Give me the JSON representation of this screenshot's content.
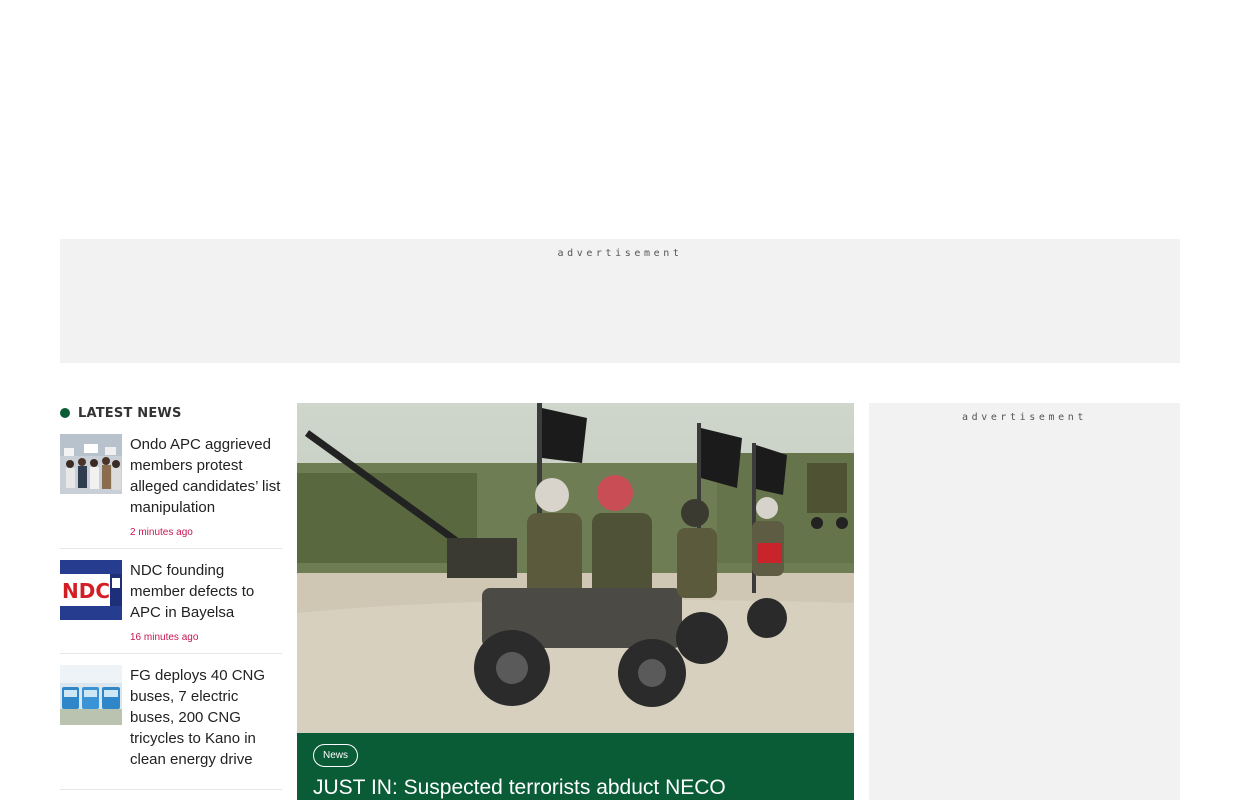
{
  "ads": {
    "banner_label": "advertisement",
    "sidebar_label": "advertisement"
  },
  "latest_news": {
    "title": "LATEST NEWS",
    "items": [
      {
        "headline": "Ondo APC aggrieved members protest alleged candidates’ list manipulation",
        "time": "2 minutes ago",
        "thumb_icon": "protest-photo"
      },
      {
        "headline": "NDC founding member defects to APC in Bayelsa",
        "time": "16 minutes ago",
        "thumb_icon": "ndc-logo-photo"
      },
      {
        "headline": "FG deploys 40 CNG buses, 7 electric buses, 200 CNG tricycles to Kano in clean energy drive",
        "time": "",
        "thumb_icon": "buses-photo"
      }
    ]
  },
  "featured": {
    "category": "News",
    "title": "JUST IN: Suspected terrorists abduct NECO",
    "image_icon": "armed-men-photo"
  },
  "colors": {
    "brand_green": "#0a5c36",
    "time_red": "#c4174f",
    "ad_bg": "#f2f2f2"
  }
}
